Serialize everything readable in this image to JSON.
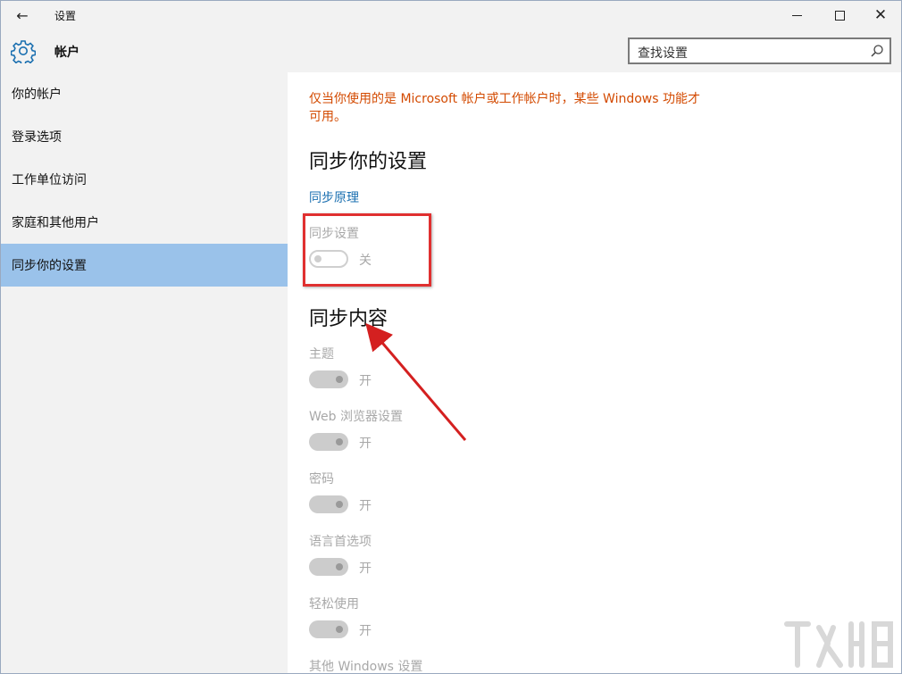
{
  "window": {
    "title": "设置",
    "back_icon": "←",
    "close_icon": "✕"
  },
  "header": {
    "title": "帐户",
    "search_placeholder": "查找设置"
  },
  "sidebar": {
    "items": [
      {
        "label": "你的帐户"
      },
      {
        "label": "登录选项"
      },
      {
        "label": "工作单位访问"
      },
      {
        "label": "家庭和其他用户"
      },
      {
        "label": "同步你的设置"
      }
    ]
  },
  "content": {
    "notice": "仅当你使用的是 Microsoft 帐户或工作帐户时，某些 Windows 功能才可用。",
    "sync_heading": "同步你的设置",
    "sync_link": "同步原理",
    "sync_setting": {
      "label": "同步设置",
      "state": "关"
    },
    "content_heading": "同步内容",
    "items": [
      {
        "label": "主题",
        "state": "开"
      },
      {
        "label": "Web 浏览器设置",
        "state": "开"
      },
      {
        "label": "密码",
        "state": "开"
      },
      {
        "label": "语言首选项",
        "state": "开"
      },
      {
        "label": "轻松使用",
        "state": "开"
      },
      {
        "label": "其他 Windows 设置"
      }
    ]
  },
  "colors": {
    "accent": "#9ac2ea",
    "notice": "#d34a00",
    "link": "#1a6fb0",
    "annotation": "#e03030"
  }
}
